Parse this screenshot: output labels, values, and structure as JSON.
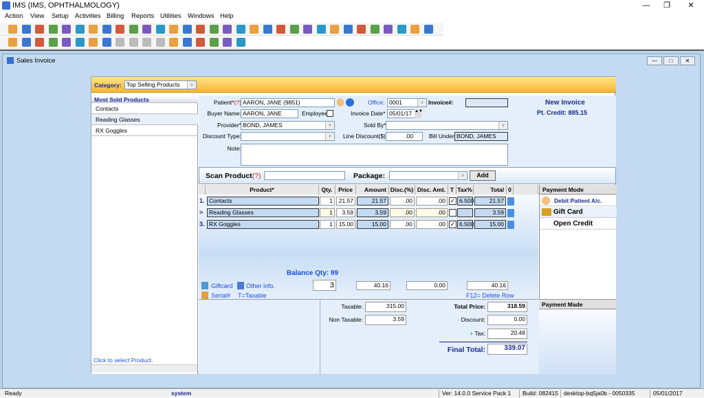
{
  "app": {
    "title": "IMS (IMS, OPHTHALMOLOGY)",
    "menu": [
      "Action",
      "View",
      "Setup",
      "Activities",
      "Billing",
      "Reports",
      "Utilities",
      "Windows",
      "Help"
    ]
  },
  "toolbar1_icons": [
    "patient-icon",
    "patient-edit-icon",
    "patient-check-icon",
    "folder-icon",
    "edit-record-icon",
    "prescription-icon",
    "lab-flask-icon",
    "document-icon",
    "copy-icon",
    "dollar-icon",
    "billing-icon",
    "ledger-icon",
    "payment-icon",
    "claims-icon",
    "calendar-icon",
    "tools-icon",
    "report-icon",
    "letter-icon",
    "box-icon",
    "package-icon",
    "export-icon",
    "import-icon",
    "chart-icon",
    "chart2-icon",
    "table-icon",
    "cut-icon",
    "transfer-icon",
    "refresh2-icon",
    "window-icon",
    "help-icon",
    "lock-icon",
    "exit-icon"
  ],
  "toolbar2_icons": [
    "open-icon",
    "find-icon",
    "add-icon",
    "edit-icon",
    "delete-icon",
    "save-icon",
    "undo-icon",
    "print-icon",
    "first-icon",
    "prev-icon",
    "next-icon",
    "last-icon",
    "sort-icon",
    "preview-icon",
    "refresh-icon",
    "fax-icon",
    "help-icon",
    "close-icon"
  ],
  "window": {
    "title": "Sales Invoice"
  },
  "category": {
    "label": "Category:",
    "value": "Top Selling Products"
  },
  "most_sold": {
    "header": "Most Sold Products",
    "items": [
      "Contacts",
      "Reading Glasses",
      "RX Goggles"
    ],
    "hint": "Click to select Product."
  },
  "form": {
    "patient_label": "Patient*",
    "q": "(?)",
    "patient": "AARON, JANE  (9851)",
    "office_label": "Office:",
    "office": "0001",
    "invoice_label": "Invoice#:",
    "invoice": "",
    "buyer_label": "Buyer Name:",
    "buyer": "AARON, JANE",
    "employee_label": "Employee:",
    "date_label": "Invoice Date*",
    "date": "05/01/17",
    "provider_label": "Provider*",
    "provider": "BOND, JAMES",
    "soldby_label": "Sold By*",
    "soldby": "",
    "disctype_label": "Discount Type:",
    "disctype": "",
    "linedisc_label": "Line Discount($):",
    "linedisc": ".00",
    "billunder_label": "Bill Under:",
    "billunder": "BOND, JAMES",
    "note_label": "Note:",
    "note": "",
    "status": "New Invoice",
    "credit": "Pt. Credit: 885.15"
  },
  "scan": {
    "label": "Scan Product",
    "q": "(?)",
    "value": "",
    "package_label": "Package:",
    "package": "",
    "add": "Add"
  },
  "grid": {
    "headers": [
      "Product*",
      "Qty.",
      "Price",
      "Amount",
      "Disc.(%)",
      "Disc. Amt.",
      "T",
      "Tax%",
      "Total",
      "0"
    ],
    "rows": [
      {
        "num": "1.",
        "product": "Contacts",
        "qty": "1",
        "price": "21.57",
        "amount": "21.57",
        "discp": ".00",
        "disca": ".00",
        "taxable": true,
        "tax": "6.500",
        "total": "21.57"
      },
      {
        "num": ">",
        "product": "Reading Glasses",
        "qty": "1",
        "price": "3.59",
        "amount": "3.59",
        "discp": ".00",
        "disca": ".00",
        "taxable": false,
        "tax": "",
        "total": "3.59"
      },
      {
        "num": "3.",
        "product": "RX Goggles",
        "qty": "1",
        "price": "15.00",
        "amount": "15.00",
        "discp": ".00",
        "disca": ".00",
        "taxable": true,
        "tax": "6.500",
        "total": "15.00"
      }
    ],
    "balance": "Balance Qty: 99",
    "sum_qty": "3",
    "sum_amount": "40.16",
    "sum_disc": "0.00",
    "sum_total": "40.16",
    "giftcard": "Giftcard",
    "other": "Other info.",
    "serial": "Serial#",
    "taxable_note": "T=Taxable",
    "delete_hint": "F12= Delete Row"
  },
  "payment": {
    "header": "Payment Mode",
    "items": [
      "Debit Patient A/c.",
      "Gift Card",
      "Open Credit"
    ],
    "made_header": "Payment Made"
  },
  "totals": {
    "taxable_label": "Taxable:",
    "taxable": "315.00",
    "nontaxable_label": "Non Taxable:",
    "nontaxable": "3.59",
    "total_price_label": "Total Price:",
    "total_price": "318.59",
    "discount_sign": "-",
    "discount_label": "Discount:",
    "discount": "0.00",
    "tax_sign": "+",
    "tax_label": "Tax:",
    "tax": "20.48",
    "final_label": "Final Total:",
    "final": "339.07"
  },
  "status": {
    "ready": "Ready",
    "user": "system",
    "version": "Ver: 14.0.0 Service Pack 1",
    "build": "Build: 082415",
    "machine": "desktop-bq5ja0b - 0050335",
    "date": "05/01/2017"
  },
  "colors": {
    "accent": "#1a2a8c",
    "link": "#1a4ee0",
    "category_bar": "#f9b535"
  }
}
